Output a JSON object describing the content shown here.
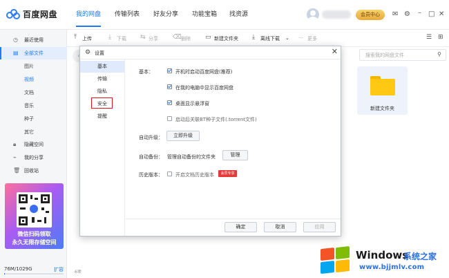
{
  "app": {
    "title": "百度网盘"
  },
  "nav": [
    {
      "label": "我的网盘"
    },
    {
      "label": "传输列表"
    },
    {
      "label": "好友分享"
    },
    {
      "label": "功能宝箱"
    },
    {
      "label": "找资源"
    }
  ],
  "header": {
    "vip_label": "会员中心"
  },
  "sidebar": {
    "items": [
      {
        "label": "最近使用",
        "icon": "clock-icon"
      },
      {
        "label": "全部文件",
        "icon": "file-icon"
      },
      {
        "label": "隐藏空间",
        "icon": "lock-icon"
      },
      {
        "label": "我的分享",
        "icon": "share-icon"
      },
      {
        "label": "回收站",
        "icon": "trash-icon"
      }
    ],
    "sub_items": [
      {
        "label": "图片"
      },
      {
        "label": "视频"
      },
      {
        "label": "文档"
      },
      {
        "label": "音乐"
      },
      {
        "label": "种子"
      },
      {
        "label": "其它"
      }
    ],
    "promo": {
      "line1": "微信扫码领取",
      "line2": "永久无限存储空间"
    },
    "storage": {
      "used": "76M/1029G",
      "fraction": 0.0001,
      "expand_label": "扩容"
    }
  },
  "toolbar": {
    "upload": "上传",
    "download": "下载",
    "share": "分享",
    "delete": "删除",
    "new_folder": "新建文件夹",
    "offline_download": "离线下载",
    "more": "更多"
  },
  "search": {
    "placeholder": "搜索我的网盘文件"
  },
  "files": [
    {
      "name": "新建文件夹"
    }
  ],
  "status": {
    "count": "6项"
  },
  "dialog": {
    "title": "设置",
    "nav": [
      {
        "label": "基本"
      },
      {
        "label": "传输"
      },
      {
        "label": "隐私"
      },
      {
        "label": "安全"
      },
      {
        "label": "提醒"
      }
    ],
    "basic_label": "基本：",
    "options": [
      {
        "label": "开机时启动百度网盘(推荐)",
        "checked": true
      },
      {
        "label": "在我的电脑中显示百度网盘",
        "checked": true
      },
      {
        "label": "桌面显示悬浮窗",
        "checked": true
      },
      {
        "label": "启动后关联BT种子文件(.torrent文件)",
        "checked": false
      }
    ],
    "auto_upgrade_label": "自动升级：",
    "upgrade_button": "立即升级",
    "auto_backup_label": "自动备份：",
    "backup_desc": "管理自动备份的文件夹",
    "manage_button": "管理",
    "history_label": "历史版本：",
    "history_option": "开启文档历史版本",
    "vip_badge": "会员专享",
    "ok": "确定",
    "cancel": "取消",
    "apply": "应用"
  },
  "watermark": {
    "brand": "Windows",
    "cn": "系统之家",
    "url": "www.bjjmlv.com"
  }
}
